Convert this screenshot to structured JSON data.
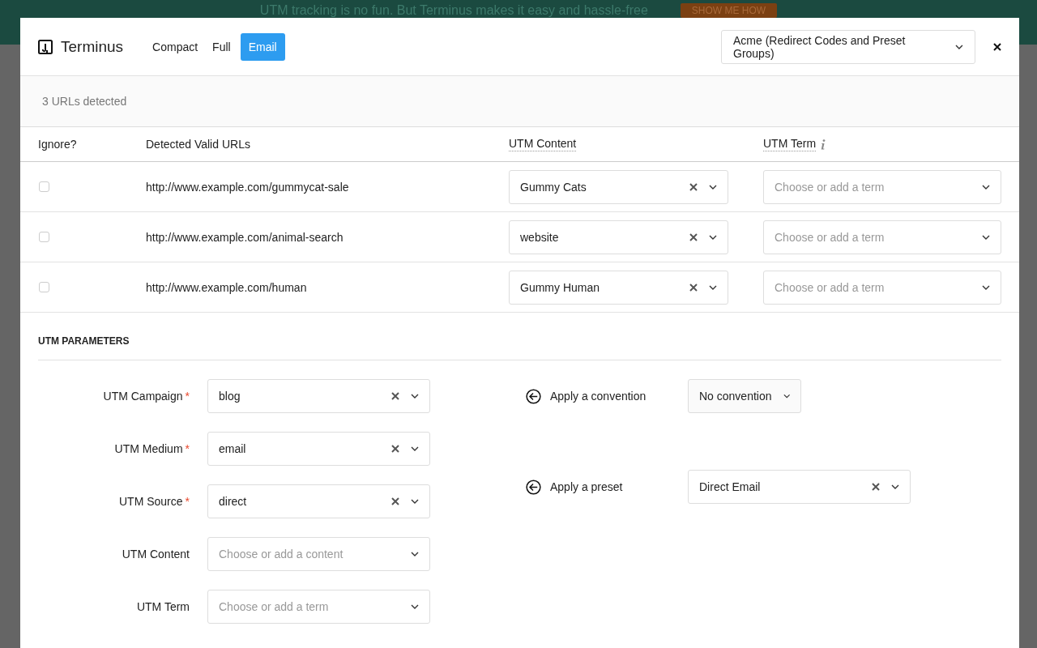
{
  "banner": {
    "text": "UTM tracking is no fun. But Terminus makes it easy and hassle-free",
    "button": "SHOW ME HOW"
  },
  "header": {
    "app_name": "Terminus",
    "tabs": [
      {
        "label": "Compact",
        "selected": false
      },
      {
        "label": "Full",
        "selected": false
      },
      {
        "label": "Email",
        "selected": true
      }
    ],
    "account": "Acme (Redirect Codes and Preset Groups)"
  },
  "detected": "3 URLs detected",
  "table": {
    "columns": [
      "Ignore?",
      "Detected Valid URLs",
      "UTM Content",
      "UTM Term"
    ],
    "rows": [
      {
        "checked": false,
        "url": "http://www.example.com/gummycat-sale",
        "content": "Gummy Cats",
        "term_placeholder": "Choose or add a term"
      },
      {
        "checked": false,
        "url": "http://www.example.com/animal-search",
        "content": "website",
        "term_placeholder": "Choose or add a term"
      },
      {
        "checked": false,
        "url": "http://www.example.com/human",
        "content": "Gummy Human",
        "term_placeholder": "Choose or add a term"
      }
    ]
  },
  "parameters": {
    "title": "UTM PARAMETERS",
    "fields": [
      {
        "label": "UTM Campaign",
        "required_mark": "*",
        "value": "blog"
      },
      {
        "label": "UTM Medium",
        "required_mark": "*",
        "value": "email"
      },
      {
        "label": "UTM Source",
        "required_mark": "*",
        "value": "direct"
      },
      {
        "label": "UTM Content",
        "placeholder": "Choose or add a content"
      },
      {
        "label": "UTM Term",
        "placeholder": "Choose or add a term"
      }
    ],
    "convention": {
      "label": "Apply a convention",
      "value": "No convention"
    },
    "preset": {
      "label": "Apply a preset",
      "value": "Direct Email"
    }
  }
}
